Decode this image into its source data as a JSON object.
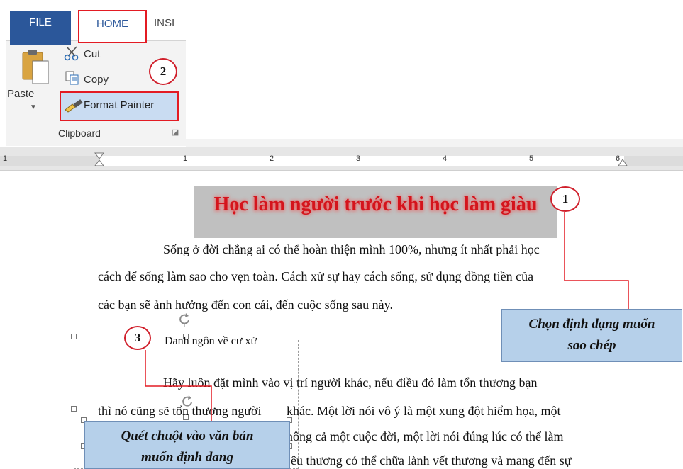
{
  "ribbon": {
    "tabs": {
      "file": "FILE",
      "home": "HOME",
      "insert": "INSI"
    },
    "clipboard": {
      "paste": "Paste",
      "cut": "Cut",
      "copy": "Copy",
      "format_painter": "Format Painter",
      "group_label": "Clipboard"
    }
  },
  "ruler": {
    "numbers": [
      "1",
      "1",
      "2",
      "3",
      "4",
      "5",
      "6"
    ]
  },
  "document": {
    "title": "Học làm người trước khi học làm giàu",
    "paragraph1": {
      "line1": "Sống ở đời chẳng ai có thể hoàn thiện mình 100%, nhưng ít nhất phải học",
      "line2": "cách để sống làm sao cho vẹn toàn. Cách xử sự hay cách sống, sử dụng đồng tiền của",
      "line3": "các bạn sẽ ảnh hưởng đến con cái, đến cuộc sống sau này."
    },
    "subheading": "Danh ngôn về cư xử",
    "paragraph2": {
      "line1": "Hãy luôn đặt mình vào vị trí người khác, nếu điều đó làm tổn thương bạn",
      "line2_left": "thì nó cũng sẽ tổn thương người",
      "line2_right": "khác. Một lời nói vô ý là một xung đột hiểm họa, một",
      "line3": "hông cả một cuộc đời, một lời nói đúng lúc có thể làm",
      "line4": "êu thương có thể chữa lành vết thương và mang đến sự"
    }
  },
  "annotations": {
    "step1": "1",
    "step2": "2",
    "step3": "3",
    "callout1_line1": "Chọn định dạng muốn",
    "callout1_line2": "sao chép",
    "callout3_line1": "Quét chuột vào văn bản",
    "callout3_line2": "muốn định dang"
  },
  "colors": {
    "file_tab": "#2b579a",
    "highlight_red": "#e31b23",
    "title_red": "#d4141c",
    "callout_blue": "#b6d0ea",
    "format_painter_active": "#c9dcf2"
  }
}
